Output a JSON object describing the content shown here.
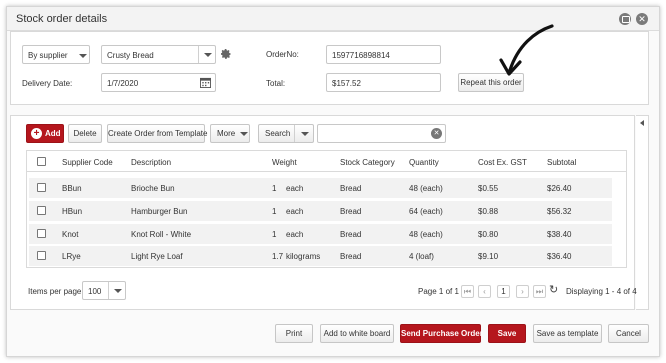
{
  "window": {
    "title": "Stock order details"
  },
  "header": {
    "filter_by": "By supplier",
    "supplier": "Crusty Bread",
    "order_no_label": "OrderNo:",
    "order_no": "1597716898814",
    "delivery_label": "Delivery Date:",
    "delivery_date": "1/7/2020",
    "total_label": "Total:",
    "total": "$157.52",
    "repeat_label": "Repeat this order"
  },
  "toolbar": {
    "add": "Add",
    "delete": "Delete",
    "create_template": "Create Order from Template",
    "more": "More",
    "search": "Search",
    "search_value": ""
  },
  "table": {
    "columns": [
      "Supplier Code",
      "Description",
      "Weight",
      "Stock Category",
      "Quantity",
      "Cost Ex. GST",
      "Subtotal"
    ],
    "rows": [
      {
        "code": "BBun",
        "description": "Brioche Bun",
        "weight": "1",
        "unit": "each",
        "category": "Bread",
        "quantity": "48 (each)",
        "cost": "$0.55",
        "subtotal": "$26.40"
      },
      {
        "code": "HBun",
        "description": "Hamburger Bun",
        "weight": "1",
        "unit": "each",
        "category": "Bread",
        "quantity": "64 (each)",
        "cost": "$0.88",
        "subtotal": "$56.32"
      },
      {
        "code": "Knot",
        "description": "Knot Roll - White",
        "weight": "1",
        "unit": "each",
        "category": "Bread",
        "quantity": "48 (each)",
        "cost": "$0.80",
        "subtotal": "$38.40"
      },
      {
        "code": "LRye",
        "description": "Light Rye Loaf",
        "weight": "1.7",
        "unit": "kilograms",
        "category": "Bread",
        "quantity": "4 (loaf)",
        "cost": "$9.10",
        "subtotal": "$36.40"
      }
    ]
  },
  "pager": {
    "items_label": "Items per page:",
    "items_per_page": "100",
    "page_label": "Page 1 of 1",
    "current_page": "1",
    "display_label": "Displaying 1 - 4 of 4"
  },
  "footer": {
    "print": "Print",
    "whiteboard": "Add to white board",
    "send_po": "Send Purchase Order",
    "save": "Save",
    "save_template": "Save as template",
    "cancel": "Cancel"
  },
  "colors": {
    "brand_red": "#b5161d",
    "row_bg": "#f2f2f2"
  }
}
